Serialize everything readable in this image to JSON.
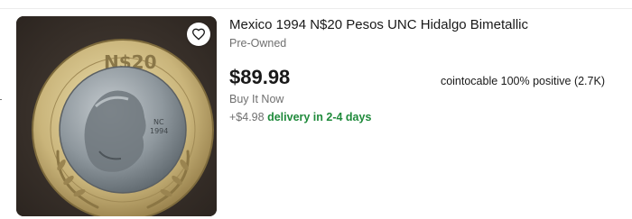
{
  "listing": {
    "title": "Mexico 1994 N$20 Pesos UNC Hidalgo Bimetallic",
    "condition": "Pre-Owned",
    "price": "$89.98",
    "buying_format": "Buy It Now",
    "shipping_cost": "+$4.98",
    "delivery_text": "delivery in 2-4 days",
    "seller_info": "cointocable 100% positive (2.7K)"
  },
  "image": {
    "coin_rim_text": "N$20",
    "coin_side_text": [
      "NC",
      "1994"
    ],
    "watch_icon": "heart-icon"
  },
  "colors": {
    "delivery_green": "#1f8a3b",
    "muted_text": "#707070",
    "primary_text": "#191919"
  }
}
